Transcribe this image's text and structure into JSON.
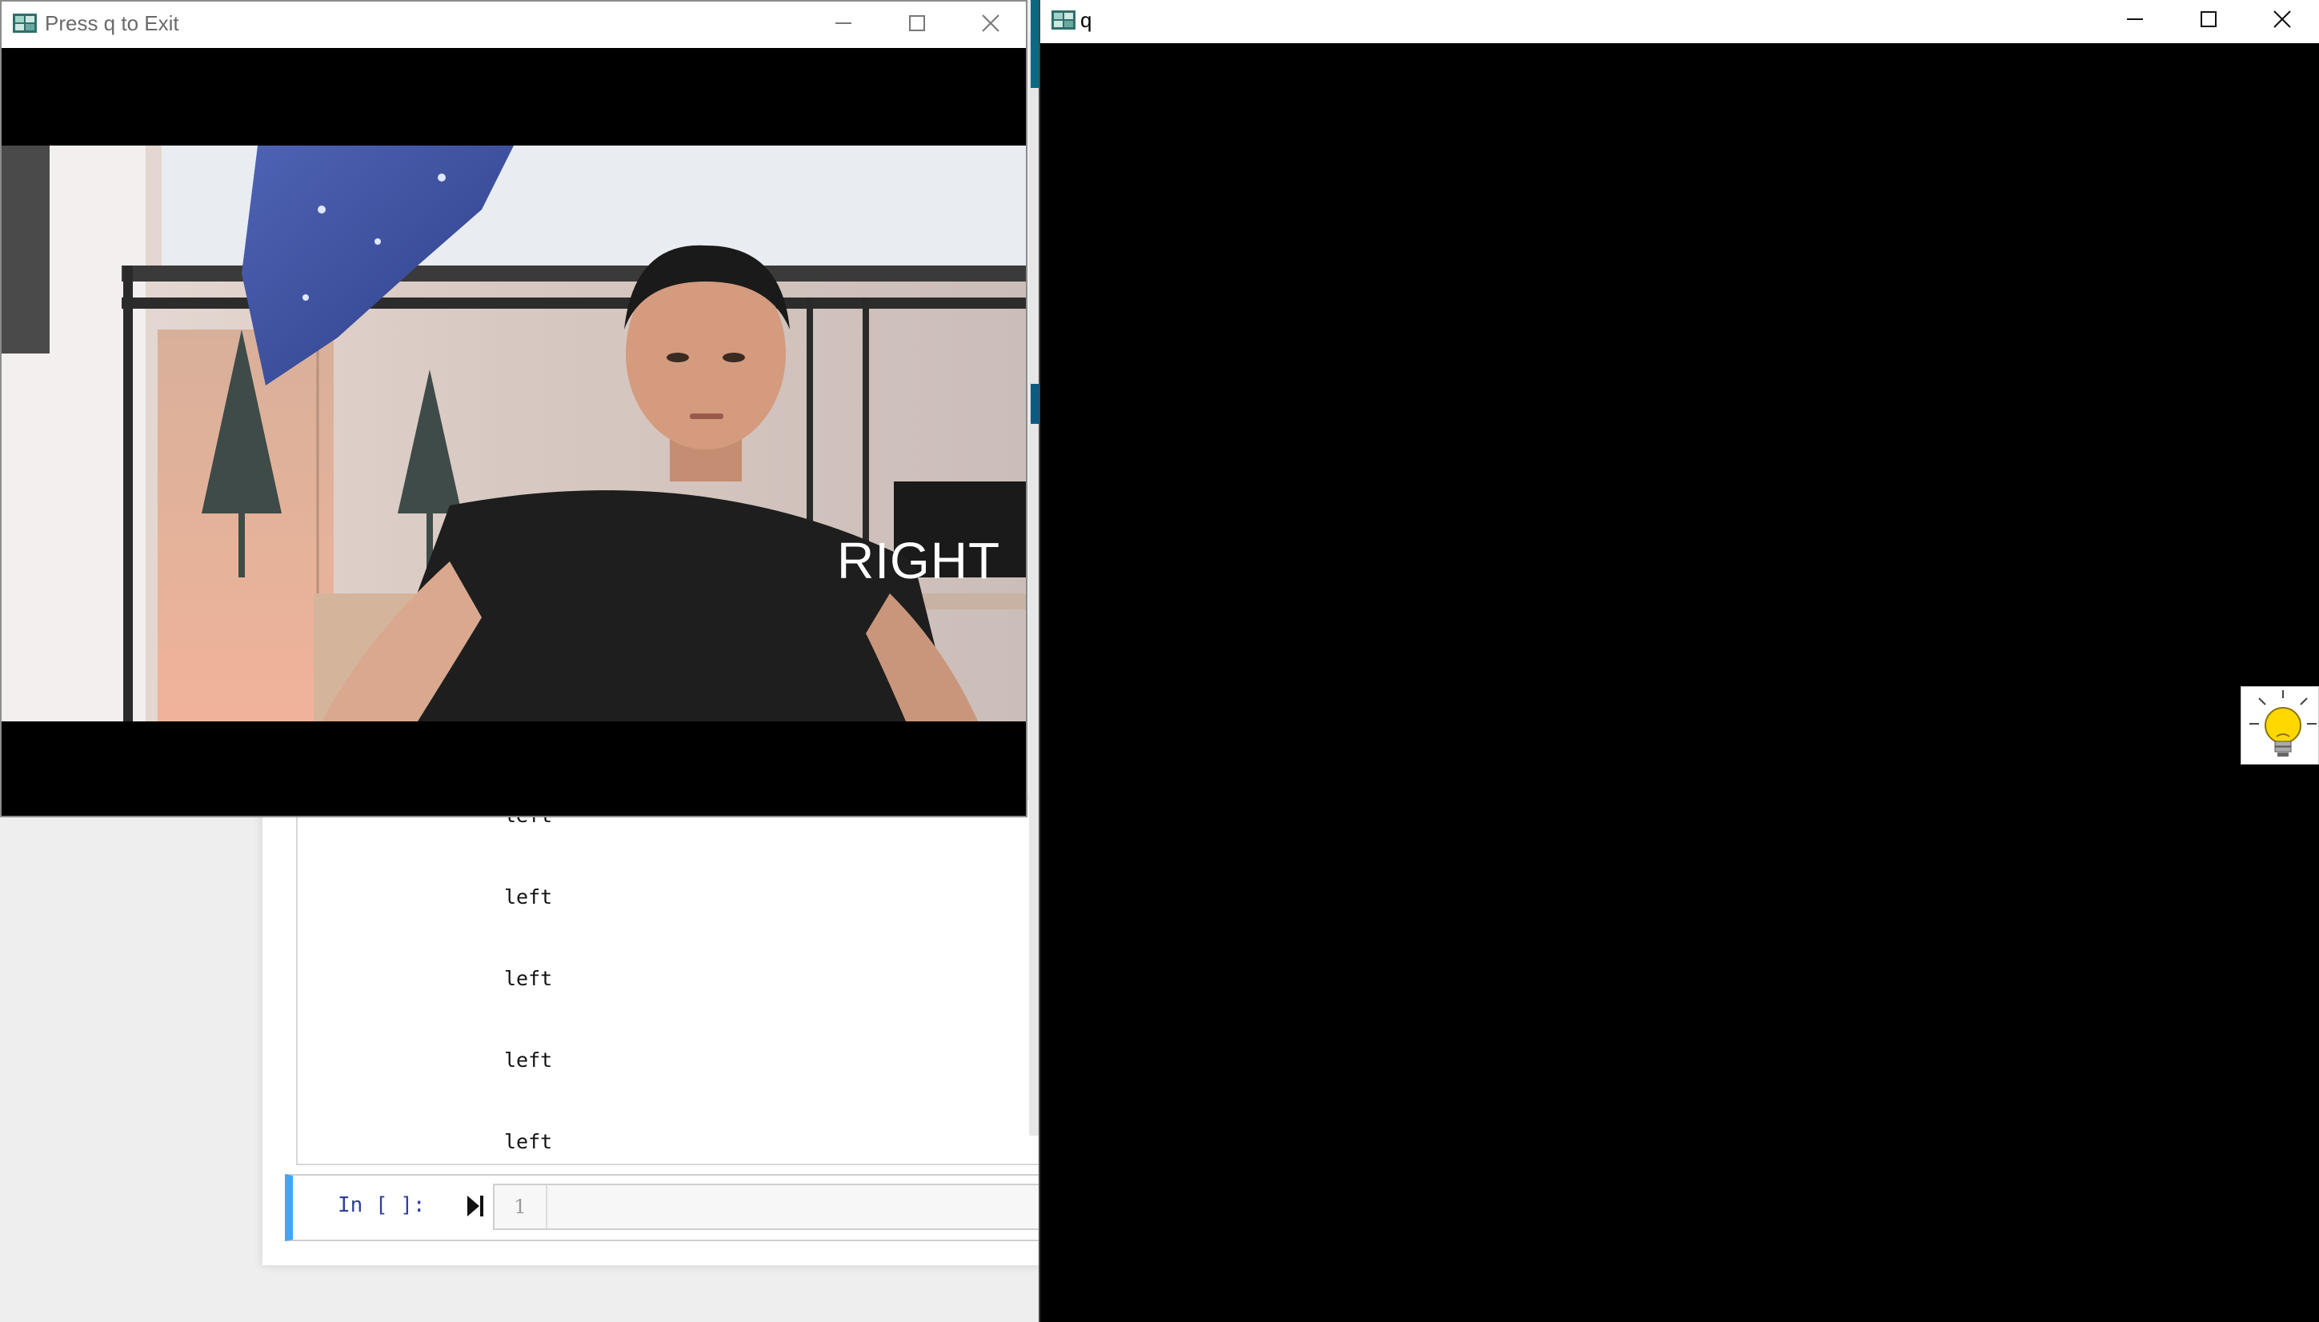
{
  "camera_window": {
    "title": "Press q to Exit",
    "overlay_text": "RIGHT",
    "controls": {
      "minimize": "—",
      "maximize": "☐",
      "close": "✕"
    }
  },
  "q_window": {
    "title": "q",
    "controls": {
      "minimize": "—",
      "maximize": "☐",
      "close": "✕"
    }
  },
  "notebook": {
    "output_lines": [
      "left",
      "left",
      "left",
      "left",
      "left"
    ],
    "prompt": "In [ ]:",
    "line_number": "1"
  },
  "icons": {
    "window_app_icon": "opencv-window-icon",
    "run_cell": "run-cell-icon",
    "lightbulb": "lightbulb-icon"
  }
}
